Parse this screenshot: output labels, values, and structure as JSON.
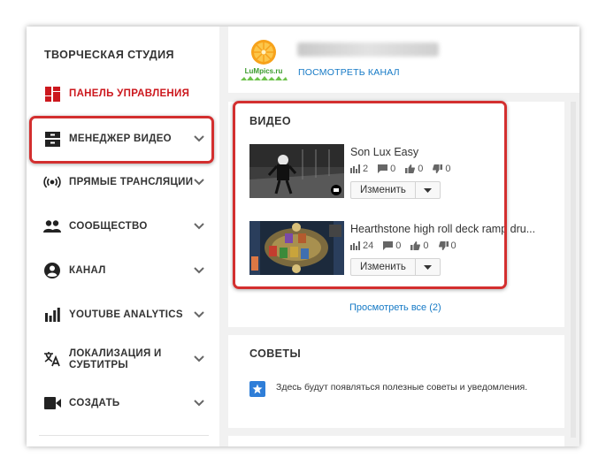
{
  "sidebar": {
    "title": "ТВОРЧЕСКАЯ СТУДИЯ",
    "items": [
      {
        "label": "ПАНЕЛЬ УПРАВЛЕНИЯ",
        "icon": "dashboard-icon"
      },
      {
        "label": "МЕНЕДЖЕР ВИДЕО",
        "icon": "video-manager-icon"
      },
      {
        "label": "ПРЯМЫЕ ТРАНСЛЯЦИИ",
        "icon": "live-broadcast-icon"
      },
      {
        "label": "СООБЩЕСТВО",
        "icon": "community-icon"
      },
      {
        "label": "КАНАЛ",
        "icon": "channel-icon"
      },
      {
        "label": "YOUTUBE ANALYTICS",
        "icon": "analytics-icon"
      },
      {
        "label_line1": "ЛОКАЛИЗАЦИЯ И",
        "label_line2": "СУБТИТРЫ",
        "icon": "translate-icon"
      },
      {
        "label": "СОЗДАТЬ",
        "icon": "create-video-icon"
      }
    ],
    "active_color": "#cc181e"
  },
  "channel": {
    "logo_text": "LuMpics.ru",
    "view_channel_link": "ПОСМОТРЕТЬ КАНАЛ"
  },
  "videos": {
    "title": "ВИДЕО",
    "items": [
      {
        "title": "Son Lux Easy",
        "views": "2",
        "comments": "0",
        "likes": "0",
        "dislikes": "0",
        "edit_label": "Изменить"
      },
      {
        "title": "Hearthstone high roll deck ramp dru...",
        "views": "24",
        "comments": "0",
        "likes": "0",
        "dislikes": "0",
        "edit_label": "Изменить"
      }
    ],
    "view_all": "Просмотреть все (2)"
  },
  "tips": {
    "title": "СОВЕТЫ",
    "text": "Здесь будут появляться полезные советы и уведомления."
  },
  "colors": {
    "link": "#167ac6",
    "highlight": "#d32f2f",
    "tips_icon": "#2f7ed8"
  }
}
